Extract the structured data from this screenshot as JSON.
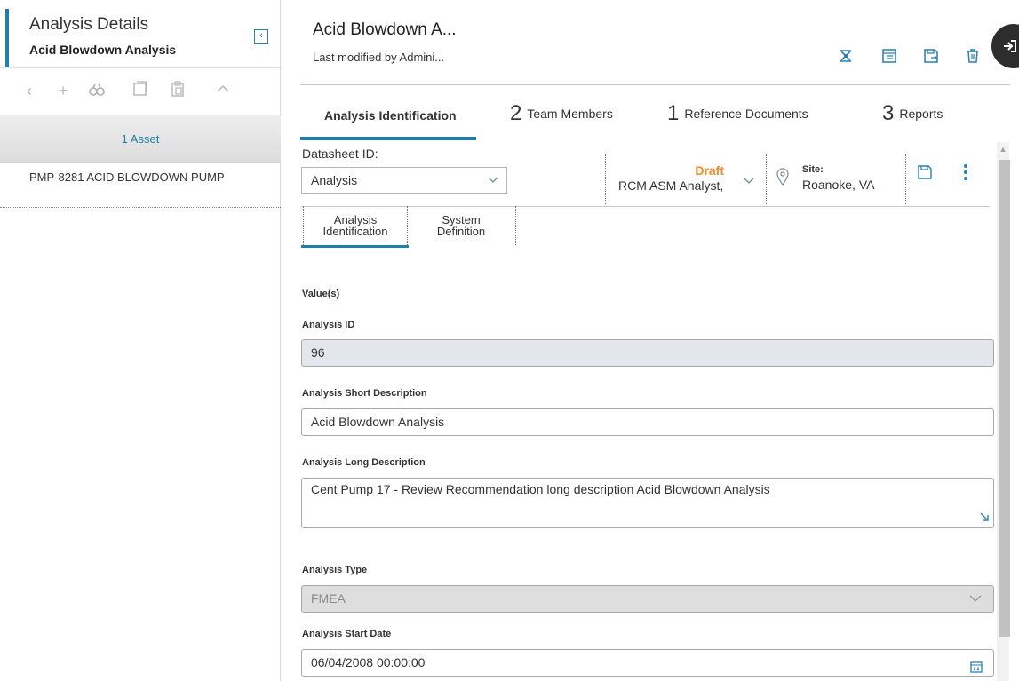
{
  "left_panel": {
    "title": "Analysis Details",
    "subtitle": "Acid Blowdown Analysis",
    "toolbar": [
      "back-icon",
      "add-icon",
      "binoculars-icon",
      "copy-icon",
      "paste-icon",
      "chevron-up-icon"
    ],
    "asset_count_label": "1 Asset",
    "assets": [
      "PMP-8281 ACID BLOWDOWN PUMP"
    ]
  },
  "header": {
    "title": "Acid Blowdown A...",
    "subtitle": "Last modified by Admini...",
    "icons": [
      "hierarchy-icon",
      "report-icon",
      "save-as-icon",
      "delete-icon"
    ]
  },
  "tabs": [
    {
      "count": "",
      "label": "Analysis Identification",
      "active": true
    },
    {
      "count": "2",
      "label": "Team Members"
    },
    {
      "count": "1",
      "label": "Reference Documents"
    },
    {
      "count": "3",
      "label": "Reports"
    }
  ],
  "datasheet": {
    "label": "Datasheet ID:",
    "value": "Analysis",
    "status": "Draft",
    "user": "RCM ASM Analyst,",
    "site_label": "Site:",
    "site_value": "Roanoke, VA"
  },
  "subtabs": [
    {
      "line1": "Analysis",
      "line2": "Identification",
      "active": true
    },
    {
      "line1": "System",
      "line2": "Definition"
    }
  ],
  "form": {
    "values_label": "Value(s)",
    "analysis_id_label": "Analysis ID",
    "analysis_id": "96",
    "short_desc_label": "Analysis Short Description",
    "short_desc": "Acid Blowdown Analysis",
    "long_desc_label": "Analysis Long Description",
    "long_desc": "Cent Pump 17 - Review Recommendation long description Acid Blowdown Analysis",
    "type_label": "Analysis Type",
    "type": "FMEA",
    "start_date_label": "Analysis Start Date",
    "start_date": "06/04/2008 00:00:00"
  },
  "colors": {
    "accent": "#1e7fa8",
    "draft": "#f08a24"
  }
}
